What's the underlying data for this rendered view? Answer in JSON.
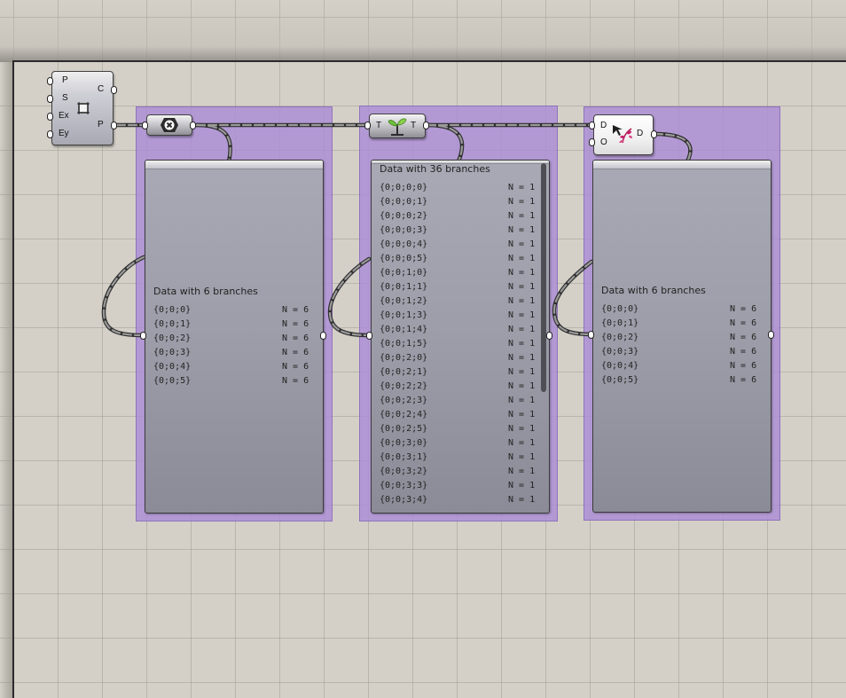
{
  "canvas": {
    "background": "#d4d0c8",
    "group_color": "#b08fd9"
  },
  "plane_component": {
    "icon": "plane-surface-icon",
    "inputs": [
      "P",
      "S",
      "Ex",
      "Ey"
    ],
    "outputs": [
      "C",
      "P"
    ]
  },
  "sort_component": {
    "icon": "close-hexagon-icon"
  },
  "tree_component": {
    "icon": "sprout-tree-icon",
    "input": "T",
    "output": "T"
  },
  "prune_component": {
    "icon": "tree-prune-icon",
    "inputs": [
      "D",
      "O"
    ],
    "output": "D"
  },
  "panel_left": {
    "title": "Data with 6 branches",
    "rows": [
      {
        "path": "{0;0;0}",
        "count": "N = 6"
      },
      {
        "path": "{0;0;1}",
        "count": "N = 6"
      },
      {
        "path": "{0;0;2}",
        "count": "N = 6"
      },
      {
        "path": "{0;0;3}",
        "count": "N = 6"
      },
      {
        "path": "{0;0;4}",
        "count": "N = 6"
      },
      {
        "path": "{0;0;5}",
        "count": "N = 6"
      }
    ]
  },
  "panel_middle": {
    "title": "Data with 36 branches",
    "rows": [
      {
        "path": "{0;0;0;0}",
        "count": "N = 1"
      },
      {
        "path": "{0;0;0;1}",
        "count": "N = 1"
      },
      {
        "path": "{0;0;0;2}",
        "count": "N = 1"
      },
      {
        "path": "{0;0;0;3}",
        "count": "N = 1"
      },
      {
        "path": "{0;0;0;4}",
        "count": "N = 1"
      },
      {
        "path": "{0;0;0;5}",
        "count": "N = 1"
      },
      {
        "path": "{0;0;1;0}",
        "count": "N = 1"
      },
      {
        "path": "{0;0;1;1}",
        "count": "N = 1"
      },
      {
        "path": "{0;0;1;2}",
        "count": "N = 1"
      },
      {
        "path": "{0;0;1;3}",
        "count": "N = 1"
      },
      {
        "path": "{0;0;1;4}",
        "count": "N = 1"
      },
      {
        "path": "{0;0;1;5}",
        "count": "N = 1"
      },
      {
        "path": "{0;0;2;0}",
        "count": "N = 1"
      },
      {
        "path": "{0;0;2;1}",
        "count": "N = 1"
      },
      {
        "path": "{0;0;2;2}",
        "count": "N = 1"
      },
      {
        "path": "{0;0;2;3}",
        "count": "N = 1"
      },
      {
        "path": "{0;0;2;4}",
        "count": "N = 1"
      },
      {
        "path": "{0;0;2;5}",
        "count": "N = 1"
      },
      {
        "path": "{0;0;3;0}",
        "count": "N = 1"
      },
      {
        "path": "{0;0;3;1}",
        "count": "N = 1"
      },
      {
        "path": "{0;0;3;2}",
        "count": "N = 1"
      },
      {
        "path": "{0;0;3;3}",
        "count": "N = 1"
      },
      {
        "path": "{0;0;3;4}",
        "count": "N = 1"
      }
    ]
  },
  "panel_right": {
    "title": "Data with 6 branches",
    "rows": [
      {
        "path": "{0;0;0}",
        "count": "N = 6"
      },
      {
        "path": "{0;0;1}",
        "count": "N = 6"
      },
      {
        "path": "{0;0;2}",
        "count": "N = 6"
      },
      {
        "path": "{0;0;3}",
        "count": "N = 6"
      },
      {
        "path": "{0;0;4}",
        "count": "N = 6"
      },
      {
        "path": "{0;0;5}",
        "count": "N = 6"
      }
    ]
  }
}
